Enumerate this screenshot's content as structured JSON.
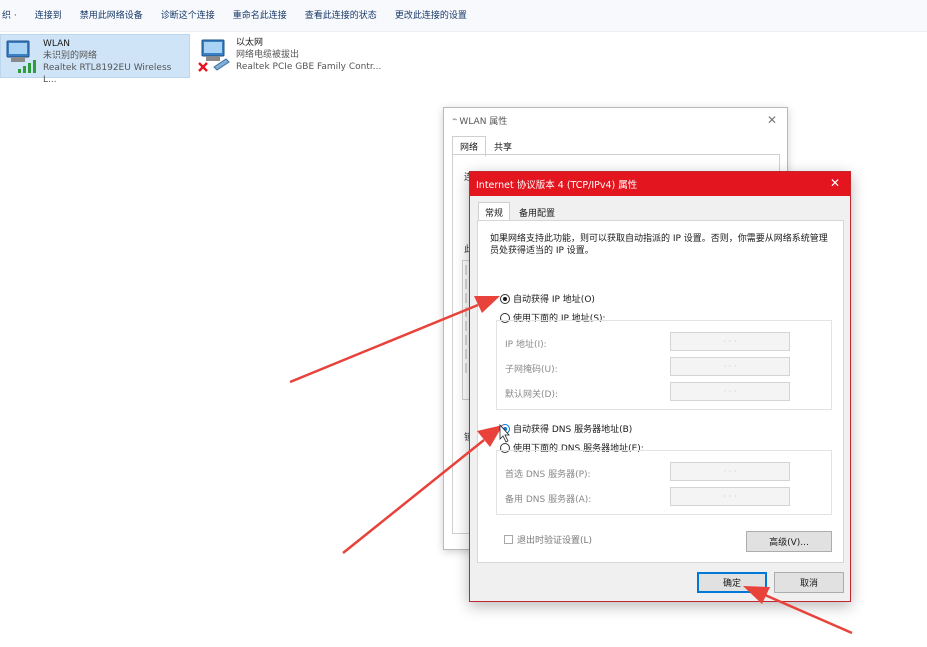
{
  "toolbar": {
    "items": [
      "织 ·",
      "连接到",
      "禁用此网络设备",
      "诊断这个连接",
      "重命名此连接",
      "查看此连接的状态",
      "更改此连接的设置"
    ]
  },
  "connections": [
    {
      "name": "WLAN",
      "status": "未识别的网络",
      "adapter": "Realtek RTL8192EU Wireless L...",
      "selected": true,
      "icon": "wireless-adapter-icon"
    },
    {
      "name": "以太网",
      "status": "网络电缆被拔出",
      "adapter": "Realtek PCIe GBE Family Contr...",
      "selected": false,
      "icon": "ethernet-disconnected-icon"
    }
  ],
  "wlan_dialog": {
    "title": "WLAN 属性",
    "tabs": [
      "网络",
      "共享"
    ],
    "fragments": [
      "连",
      "此",
      "锁"
    ]
  },
  "ipv4_dialog": {
    "title": "Internet 协议版本 4 (TCP/IPv4) 属性",
    "tabs": [
      "常规",
      "备用配置"
    ],
    "description": "如果网络支持此功能，则可以获取自动指派的 IP 设置。否则，你需要从网络系统管理员处获得适当的 IP 设置。",
    "ip_auto": "自动获得 IP 地址(O)",
    "ip_manual": "使用下面的 IP 地址(S):",
    "ip_fields": [
      "IP 地址(I):",
      "子网掩码(U):",
      "默认网关(D):"
    ],
    "dns_auto": "自动获得 DNS 服务器地址(B)",
    "dns_manual": "使用下面的 DNS 服务器地址(E):",
    "dns_fields": [
      "首选 DNS 服务器(P):",
      "备用 DNS 服务器(A):"
    ],
    "validate": "退出时验证设置(L)",
    "advanced": "高级(V)...",
    "ok": "确定",
    "cancel": "取消",
    "ip_dots": "·   ·   ·"
  },
  "colors": {
    "accent_red": "#e3151f",
    "selected_tile": "#cfe4f7",
    "annotation_arrow": "#e8423a",
    "focus_blue": "#0078d7"
  }
}
